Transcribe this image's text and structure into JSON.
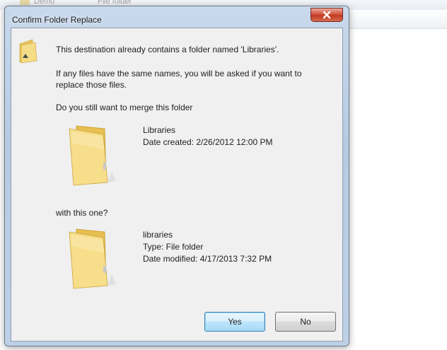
{
  "background_window": {
    "item_name": "Demo",
    "item_type": "File folder"
  },
  "dialog": {
    "title": "Confirm Folder Replace",
    "close_label": "close"
  },
  "messages": {
    "line1": "This destination already contains a folder named 'Libraries'.",
    "line2": "If any files have the same names, you will be asked if you want to replace those files.",
    "line3": "Do you still want to merge this folder",
    "with_label": "with this one?"
  },
  "source_folder": {
    "name": "Libraries",
    "date_created": "Date created: 2/26/2012 12:00 PM"
  },
  "destination_folder": {
    "name": "libraries",
    "type": "Type: File folder",
    "date_modified": "Date modified: 4/17/2013 7:32 PM"
  },
  "buttons": {
    "yes": "Yes",
    "no": "No"
  },
  "icons": {
    "header": "folder-icon",
    "source": "folder-icon",
    "destination": "folder-icon",
    "close": "close-icon"
  },
  "colors": {
    "dialog_frame": "#b6cbe3",
    "close_button": "#c03a22",
    "content_bg": "#f0f0f0",
    "folder_yellow": "#f3d878"
  }
}
